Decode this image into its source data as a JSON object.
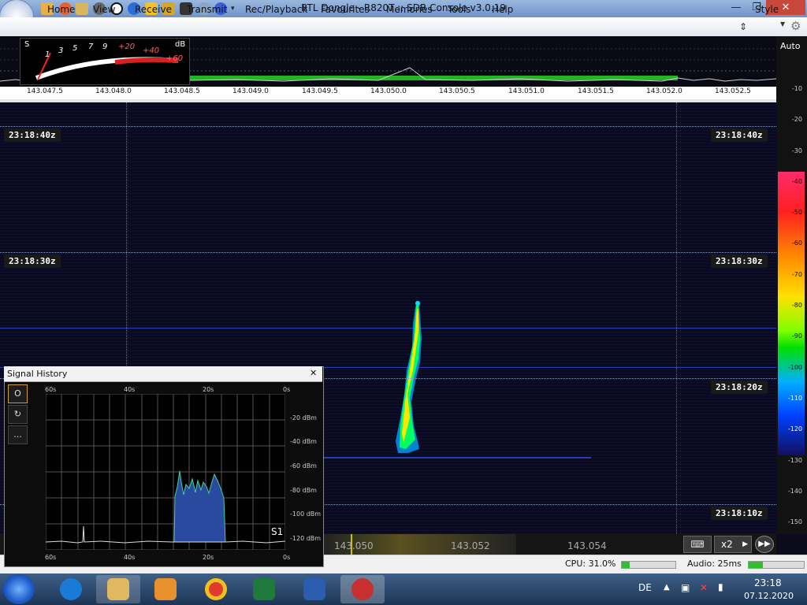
{
  "window": {
    "title": "RTL Dongle - R820T :: SDR Console v3.0.19",
    "style_label": "Style",
    "minimize_label": "—",
    "restore_label": "❐",
    "close_label": "✕"
  },
  "menu": {
    "items": [
      {
        "label": "Home"
      },
      {
        "label": "View"
      },
      {
        "label": "Receive"
      },
      {
        "label": "Transmit"
      },
      {
        "label": "Rec/Playback"
      },
      {
        "label": "Favourites"
      },
      {
        "label": "Memories"
      },
      {
        "label": "Tools"
      },
      {
        "label": "Help"
      }
    ]
  },
  "smeter": {
    "s_label": "S",
    "db_label": "dB",
    "scale": [
      "1",
      "3",
      "5",
      "7",
      "9",
      "+20",
      "+40",
      "+60"
    ]
  },
  "frequency_axis": {
    "ticks": [
      "143.047.5",
      "143.048.0",
      "143.048.5",
      "143.049.0",
      "143.049.5",
      "143.050.0",
      "143.050.5",
      "143.051.0",
      "143.051.5",
      "143.052.0",
      "143.052.5"
    ]
  },
  "scale": {
    "auto_label": "Auto",
    "values": [
      "-10",
      "-20",
      "-30",
      "-40",
      "-50",
      "-60",
      "-70",
      "-80",
      "-90",
      "-100",
      "-110",
      "-120",
      "-130",
      "-140",
      "-150"
    ]
  },
  "waterfall": {
    "time_labels": [
      "23:18:40z",
      "23:18:30z",
      "23:18:20z",
      "23:18:10z"
    ]
  },
  "bottom_strip": {
    "freq_labels": [
      "143.050",
      "143.052",
      "143.054"
    ],
    "zoom_label": "x2"
  },
  "status": {
    "cpu": "CPU: 31.0%",
    "cpu_fraction": 0.15,
    "audio": "Audio: 25ms",
    "audio_fraction": 0.25
  },
  "signal_history": {
    "title": "Signal History",
    "close_label": "✕",
    "buttons": [
      "O",
      "↻",
      "..."
    ],
    "time_axis": [
      "60s",
      "40s",
      "20s",
      "0s"
    ],
    "dbm_axis": [
      "-20 dBm",
      "-40 dBm",
      "-60 dBm",
      "-80 dBm",
      "-100 dBm",
      "-120 dBm"
    ],
    "s_label": "S1"
  },
  "taskbar": {
    "apps": [
      {
        "name": "ie-icon"
      },
      {
        "name": "explorer-icon"
      },
      {
        "name": "media-player-icon"
      },
      {
        "name": "chrome-icon"
      },
      {
        "name": "excel-icon"
      },
      {
        "name": "word-icon"
      },
      {
        "name": "sdr-console-icon"
      }
    ],
    "lang": "DE",
    "time": "23:18",
    "date": "07.12.2020"
  },
  "colors": {
    "spectrum_green": "#22b422",
    "signal_green": "#00ff50",
    "smeter_red": "#ff2020"
  }
}
